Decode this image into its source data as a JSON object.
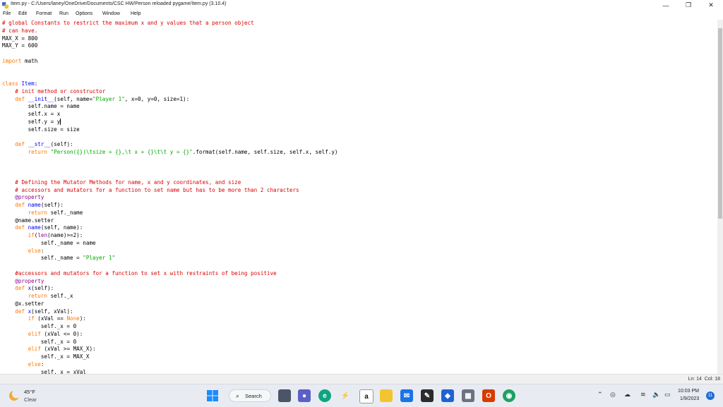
{
  "window": {
    "title": "Item.py - C:/Users/laney/OneDrive/Documents/CSC HW/Person reloaded pygame/Item.py (3.10.4)",
    "minimize_glyph": "—",
    "restore_glyph": "❐",
    "close_glyph": "✕"
  },
  "menu": [
    "File",
    "Edit",
    "Format",
    "Run",
    "Options",
    "Window",
    "Help"
  ],
  "code_lines": [
    [
      {
        "t": "# global Constants to restrict the maximum x and y values that a person object",
        "c": "comment"
      }
    ],
    [
      {
        "t": "# can have.",
        "c": "comment"
      }
    ],
    [
      {
        "t": "MAX_X = 800",
        "c": ""
      }
    ],
    [
      {
        "t": "MAX_Y = 600",
        "c": ""
      }
    ],
    [],
    [
      {
        "t": "import",
        "c": "kw"
      },
      {
        "t": " math",
        "c": ""
      }
    ],
    [],
    [],
    [
      {
        "t": "class",
        "c": "kw"
      },
      {
        "t": " ",
        "c": ""
      },
      {
        "t": "Item",
        "c": "def"
      },
      {
        "t": ":",
        "c": ""
      }
    ],
    [
      {
        "t": "    ",
        "c": ""
      },
      {
        "t": "# init method or constructor",
        "c": "comment"
      }
    ],
    [
      {
        "t": "    ",
        "c": ""
      },
      {
        "t": "def",
        "c": "kw"
      },
      {
        "t": " ",
        "c": ""
      },
      {
        "t": "__init__",
        "c": "def"
      },
      {
        "t": "(self, name=",
        "c": ""
      },
      {
        "t": "\"Player 1\"",
        "c": "str"
      },
      {
        "t": ", x=0, y=0, size=1):",
        "c": ""
      }
    ],
    [
      {
        "t": "        self.name = name",
        "c": ""
      }
    ],
    [
      {
        "t": "        self.x = x",
        "c": ""
      }
    ],
    [
      {
        "t": "        self.y = y",
        "c": "",
        "cursor": true
      }
    ],
    [
      {
        "t": "        self.size = size",
        "c": ""
      }
    ],
    [],
    [
      {
        "t": "    ",
        "c": ""
      },
      {
        "t": "def",
        "c": "kw"
      },
      {
        "t": " ",
        "c": ""
      },
      {
        "t": "__str__",
        "c": "def"
      },
      {
        "t": "(self):",
        "c": ""
      }
    ],
    [
      {
        "t": "        ",
        "c": ""
      },
      {
        "t": "return",
        "c": "kw"
      },
      {
        "t": " ",
        "c": ""
      },
      {
        "t": "\"Person({})\\tsize = {},\\t x = {}\\t\\t y = {}\"",
        "c": "str"
      },
      {
        "t": ".format(self.name, self.size, self.x, self.y)",
        "c": ""
      }
    ],
    [],
    [],
    [],
    [
      {
        "t": "    ",
        "c": ""
      },
      {
        "t": "# Defining the Mutator Methods for name, x and y coordinates, and size",
        "c": "comment"
      }
    ],
    [
      {
        "t": "    ",
        "c": ""
      },
      {
        "t": "# accessors and mutators for a function to set name but has to be more than 2 characters",
        "c": "comment"
      }
    ],
    [
      {
        "t": "    @property",
        "c": "bi"
      }
    ],
    [
      {
        "t": "    ",
        "c": ""
      },
      {
        "t": "def",
        "c": "kw"
      },
      {
        "t": " ",
        "c": ""
      },
      {
        "t": "name",
        "c": "def"
      },
      {
        "t": "(self):",
        "c": ""
      }
    ],
    [
      {
        "t": "        ",
        "c": ""
      },
      {
        "t": "return",
        "c": "kw"
      },
      {
        "t": " self._name",
        "c": ""
      }
    ],
    [
      {
        "t": "    @name.setter",
        "c": ""
      }
    ],
    [
      {
        "t": "    ",
        "c": ""
      },
      {
        "t": "def",
        "c": "kw"
      },
      {
        "t": " ",
        "c": ""
      },
      {
        "t": "name",
        "c": "def"
      },
      {
        "t": "(self, name):",
        "c": ""
      }
    ],
    [
      {
        "t": "        ",
        "c": ""
      },
      {
        "t": "if",
        "c": "kw"
      },
      {
        "t": "(",
        "c": ""
      },
      {
        "t": "len",
        "c": "bi"
      },
      {
        "t": "(name)>=2):",
        "c": ""
      }
    ],
    [
      {
        "t": "            self._name = name",
        "c": ""
      }
    ],
    [
      {
        "t": "        ",
        "c": ""
      },
      {
        "t": "else",
        "c": "kw"
      },
      {
        "t": ":",
        "c": ""
      }
    ],
    [
      {
        "t": "            self._name = ",
        "c": ""
      },
      {
        "t": "\"Player 1\"",
        "c": "str"
      }
    ],
    [],
    [
      {
        "t": "    ",
        "c": ""
      },
      {
        "t": "#accessors and mutators for a function to set x with restraints of being positive",
        "c": "comment"
      }
    ],
    [
      {
        "t": "    @property",
        "c": "bi"
      }
    ],
    [
      {
        "t": "    ",
        "c": ""
      },
      {
        "t": "def",
        "c": "kw"
      },
      {
        "t": " ",
        "c": ""
      },
      {
        "t": "x",
        "c": "def"
      },
      {
        "t": "(self):",
        "c": ""
      }
    ],
    [
      {
        "t": "        ",
        "c": ""
      },
      {
        "t": "return",
        "c": "kw"
      },
      {
        "t": " self._x",
        "c": ""
      }
    ],
    [
      {
        "t": "    @x.setter",
        "c": ""
      }
    ],
    [
      {
        "t": "    ",
        "c": ""
      },
      {
        "t": "def",
        "c": "kw"
      },
      {
        "t": " ",
        "c": ""
      },
      {
        "t": "x",
        "c": "def"
      },
      {
        "t": "(self, xVal):",
        "c": ""
      }
    ],
    [
      {
        "t": "        ",
        "c": ""
      },
      {
        "t": "if",
        "c": "kw"
      },
      {
        "t": " (xVal == ",
        "c": ""
      },
      {
        "t": "None",
        "c": "kw"
      },
      {
        "t": "):",
        "c": ""
      }
    ],
    [
      {
        "t": "            self._x = 0",
        "c": ""
      }
    ],
    [
      {
        "t": "        ",
        "c": ""
      },
      {
        "t": "elif",
        "c": "kw"
      },
      {
        "t": " (xVal <= 0):",
        "c": ""
      }
    ],
    [
      {
        "t": "            self._x = 0",
        "c": ""
      }
    ],
    [
      {
        "t": "        ",
        "c": ""
      },
      {
        "t": "elif",
        "c": "kw"
      },
      {
        "t": " (xVal >= MAX_X):",
        "c": ""
      }
    ],
    [
      {
        "t": "            self._x = MAX_X",
        "c": ""
      }
    ],
    [
      {
        "t": "        ",
        "c": ""
      },
      {
        "t": "else",
        "c": "kw"
      },
      {
        "t": ":",
        "c": ""
      }
    ],
    [
      {
        "t": "            self._x = xVal",
        "c": ""
      }
    ]
  ],
  "status": {
    "line": "Ln: 14",
    "col": "Col: 18"
  },
  "taskbar": {
    "weather": {
      "temp": "45°F",
      "desc": "Clear"
    },
    "search_label": "Search",
    "time": "10:03 PM",
    "date": "1/9/2023",
    "notification_count": "11",
    "icons": [
      "windows-start-icon",
      "search-icon",
      "file-explorer-taskview-icon",
      "teams-chat-icon",
      "edge-icon",
      "python-icon",
      "amazon-icon",
      "file-explorer-icon",
      "mail-icon",
      "idle-icon",
      "dropbox-icon",
      "calculator-icon",
      "office-icon",
      "chrome-icon"
    ]
  }
}
